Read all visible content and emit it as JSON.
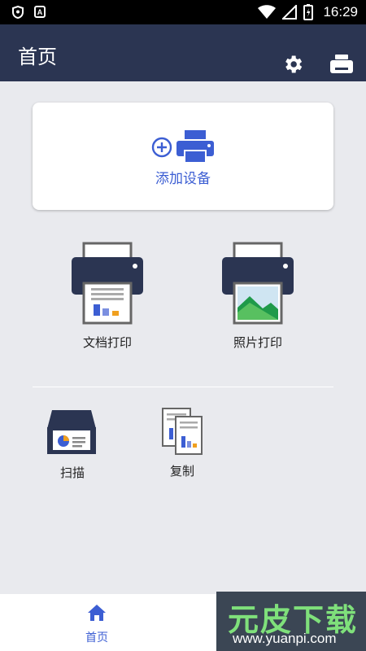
{
  "status_bar": {
    "time": "16:29",
    "left_icons": [
      "shield-icon",
      "a-icon"
    ],
    "right_icons": [
      "wifi-icon",
      "signal-icon",
      "battery-icon"
    ],
    "a_badge": "A"
  },
  "app_bar": {
    "title": "首页",
    "actions": [
      "settings-icon",
      "printer-icon"
    ]
  },
  "add_device": {
    "label": "添加设备",
    "icons": [
      "plus-circle-icon",
      "printer-icon"
    ]
  },
  "functions": {
    "doc_print": "文档打印",
    "photo_print": "照片打印",
    "scan": "扫描",
    "copy": "复制"
  },
  "bottom_nav": {
    "home_label": "首页"
  },
  "watermark": {
    "title": "元皮下载",
    "url": "www.yuanpi.com"
  },
  "colors": {
    "app_bar": "#2b3552",
    "accent": "#3c5ed3",
    "background": "#e9eaee",
    "printer_body": "#2b3552"
  }
}
